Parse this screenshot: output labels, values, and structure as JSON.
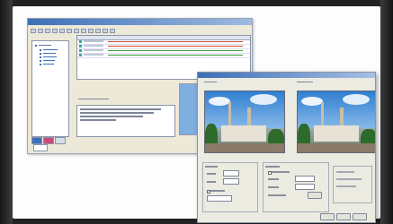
{
  "main_window": {
    "title": "",
    "menu": [
      "",
      "",
      "",
      "",
      ""
    ],
    "toolbar_button_count": 12,
    "tree_items": [
      "",
      "",
      "",
      "",
      "",
      ""
    ],
    "tabs": [
      "",
      "",
      ""
    ],
    "timeline_rows": [
      {
        "swatch_color": "#3aa6a8",
        "bar_color": "#d9453a"
      },
      {
        "swatch_color": "#3aa6a8",
        "bar_color": "#d9453a"
      },
      {
        "swatch_color": "#3aa6a8",
        "bar_color": "#3b9a3b"
      },
      {
        "swatch_color": "#3aa6a8",
        "bar_color": "#3b9a3b"
      }
    ],
    "info_title": "",
    "info_lines": 6
  },
  "dialog": {
    "title": "",
    "left_pane_label": "",
    "right_pane_label": "",
    "buttons": [
      "",
      "",
      ""
    ],
    "accent_color": "#3b6fb6"
  }
}
